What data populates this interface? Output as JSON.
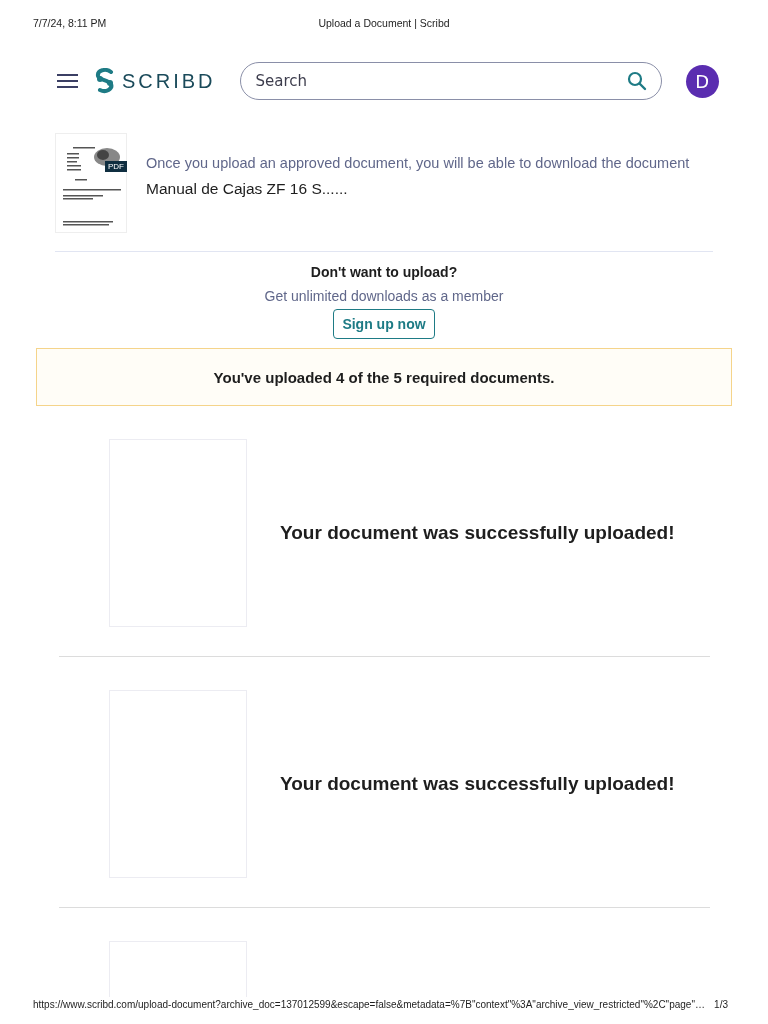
{
  "print_header": {
    "date": "7/7/24, 8:11 PM",
    "title": "Upload a Document | Scribd"
  },
  "nav": {
    "logo": "SCRIBD",
    "search": {
      "placeholder": "Search"
    },
    "avatar": "D"
  },
  "document": {
    "badge": "PDF",
    "notice": "Once you upload an approved document, you will be able to download the document",
    "title": "Manual de Cajas ZF 16 S......"
  },
  "member_prompt": {
    "heading": "Don't want to upload?",
    "subtext": "Get unlimited downloads as a member",
    "button": "Sign up now"
  },
  "progress_banner": "You've uploaded 4 of the 5 required documents.",
  "uploaded_documents": [
    {
      "kind": "uploaded",
      "message": "Your document was successfully uploaded!"
    },
    {
      "kind": "uploaded",
      "message": "Your document was successfully uploaded!"
    },
    {
      "kind": "uploaded"
    }
  ],
  "print_footer": {
    "url": "https://www.scribd.com/upload-document?archive_doc=137012599&escape=false&metadata=%7B\"context\"%3A\"archive_view_restricted\"%2C\"page\"…",
    "page": "1/3"
  }
}
